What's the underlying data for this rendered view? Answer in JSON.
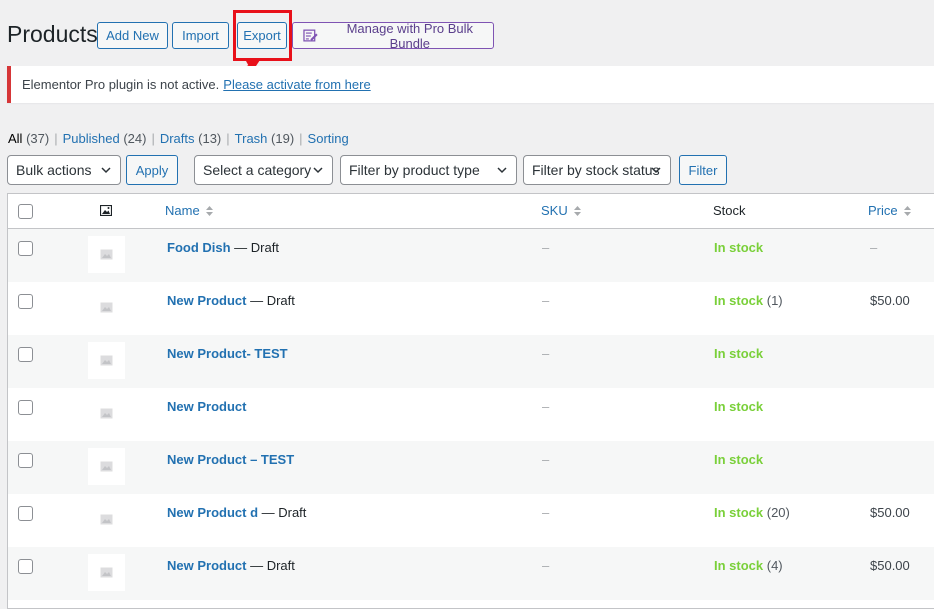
{
  "header": {
    "title": "Products",
    "add_new": "Add New",
    "import": "Import",
    "export": "Export",
    "bulk_bundle": "Manage with Pro Bulk Bundle"
  },
  "notice": {
    "text": "Elementor Pro plugin is not active.",
    "link": "Please activate from here",
    "border_color": "#d63638"
  },
  "views": [
    {
      "label": "All",
      "count": "(37)"
    },
    {
      "label": "Published",
      "count": "(24)"
    },
    {
      "label": "Drafts",
      "count": "(13)"
    },
    {
      "label": "Trash",
      "count": "(19)"
    },
    {
      "label": "Sorting",
      "count": ""
    }
  ],
  "filters": {
    "bulk_actions": "Bulk actions",
    "apply": "Apply",
    "category": "Select a category",
    "product_type": "Filter by product type",
    "stock_status": "Filter by stock status",
    "filter": "Filter"
  },
  "table": {
    "columns": {
      "name": "Name",
      "sku": "SKU",
      "stock": "Stock",
      "price": "Price"
    },
    "rows": [
      {
        "name": "Food Dish",
        "state": " — Draft",
        "sku": "–",
        "stock": "In stock",
        "qty": "",
        "price": "–"
      },
      {
        "name": "New Product",
        "state": " — Draft",
        "sku": "–",
        "stock": "In stock",
        "qty": " (1)",
        "price": "$50.00"
      },
      {
        "name": "New Product- TEST",
        "state": "",
        "sku": "–",
        "stock": "In stock",
        "qty": "",
        "price": ""
      },
      {
        "name": "New Product",
        "state": "",
        "sku": "–",
        "stock": "In stock",
        "qty": "",
        "price": ""
      },
      {
        "name": "New Product – TEST",
        "state": "",
        "sku": "–",
        "stock": "In stock",
        "qty": "",
        "price": ""
      },
      {
        "name": "New Product d",
        "state": " — Draft",
        "sku": "–",
        "stock": "In stock",
        "qty": " (20)",
        "price": "$50.00"
      },
      {
        "name": "New Product",
        "state": " — Draft",
        "sku": "–",
        "stock": "In stock",
        "qty": " (4)",
        "price": "$50.00"
      }
    ]
  },
  "colors": {
    "link": "#2271b1",
    "in_stock": "#7ad03a",
    "annotation": "#e8101a"
  }
}
